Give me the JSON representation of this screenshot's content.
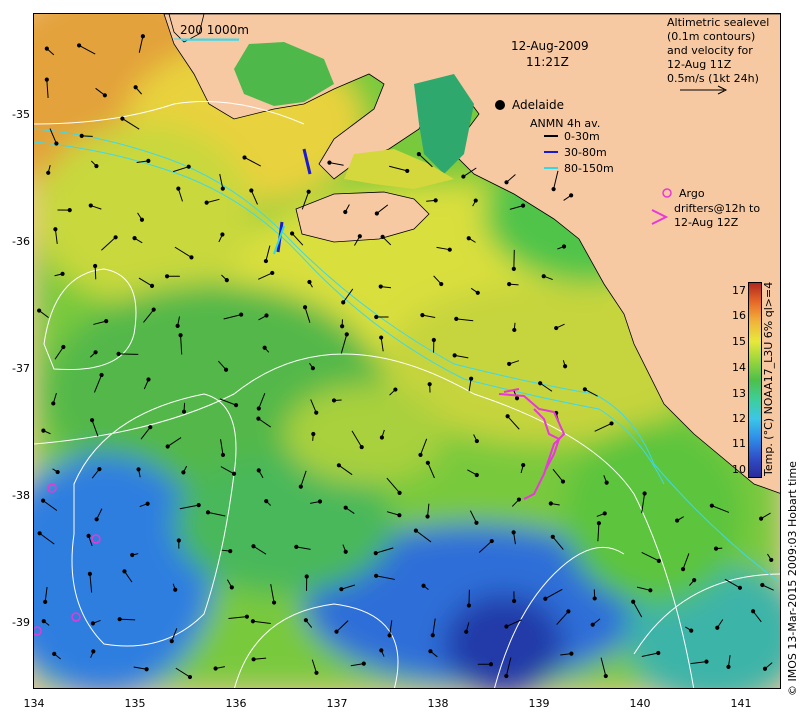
{
  "map": {
    "scale_label": "200  1000m",
    "date": "12-Aug-2009",
    "time": "11:21Z",
    "city": "Adelaide",
    "altimetry_lines": [
      "Altimetric sealevel",
      "(0.1m contours)",
      "and velocity for",
      "12-Aug 11Z",
      "0.5m/s (1kt 24h)"
    ],
    "anmn_title": "ANMN 4h av.",
    "anmn_legend": [
      {
        "label": "0-30m",
        "color": "#000000"
      },
      {
        "label": "30-80m",
        "color": "#1a1ad0"
      },
      {
        "label": "80-150m",
        "color": "#30d8e8"
      }
    ],
    "argo_label": "Argo",
    "drifters_lines": [
      "drifters@12h to",
      "12-Aug 12Z"
    ],
    "drifter_color": "#e838d8"
  },
  "axes": {
    "x_ticks": [
      "134",
      "135",
      "136",
      "137",
      "138",
      "139",
      "140",
      "141"
    ],
    "y_ticks": [
      "-35",
      "-36",
      "-37",
      "-38",
      "-39"
    ]
  },
  "colorbar": {
    "ticks": [
      "10",
      "11",
      "12",
      "13",
      "14",
      "15",
      "16",
      "17"
    ],
    "label": "Temp. (°C) NOAA17_L3U 6% ql>=4"
  },
  "credit": "© IMOS 13-Mar-2015 2009:03 Hobart time"
}
